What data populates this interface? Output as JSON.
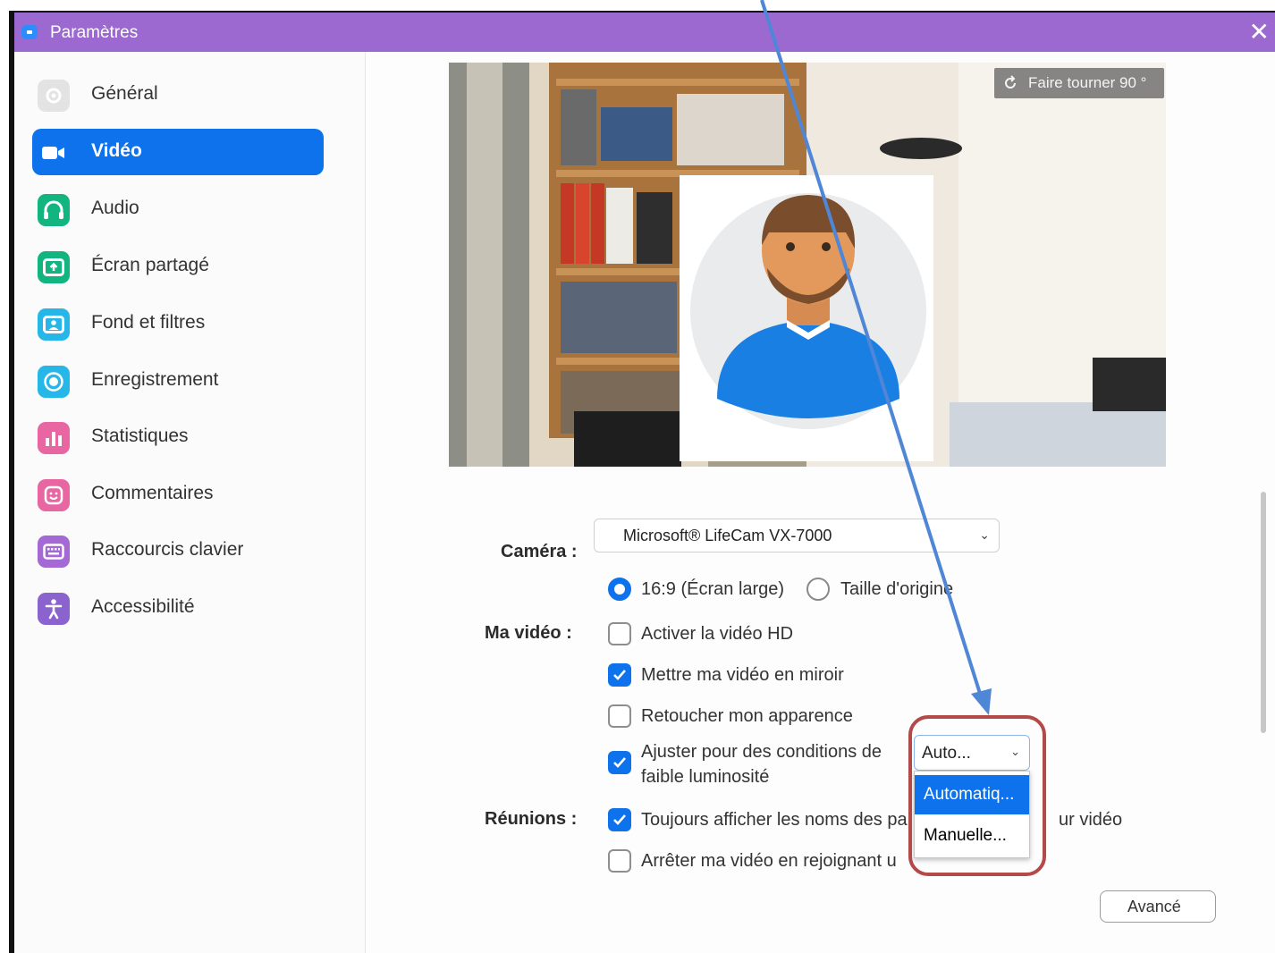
{
  "window": {
    "title": "Paramètres"
  },
  "sidebar": {
    "items": [
      {
        "label": "Général",
        "icon": "gear-icon",
        "color": "#e3e3e3",
        "active": false
      },
      {
        "label": "Vidéo",
        "icon": "video-camera-icon",
        "color": "#0e72ed",
        "active": true
      },
      {
        "label": "Audio",
        "icon": "headphones-icon",
        "color": "#12b57f",
        "active": false
      },
      {
        "label": "Écran partagé",
        "icon": "share-screen-icon",
        "color": "#12b57f",
        "active": false
      },
      {
        "label": "Fond et filtres",
        "icon": "background-person-icon",
        "color": "#26b6e8",
        "active": false
      },
      {
        "label": "Enregistrement",
        "icon": "record-icon",
        "color": "#26b6e8",
        "active": false
      },
      {
        "label": "Statistiques",
        "icon": "bar-chart-icon",
        "color": "#e867a3",
        "active": false
      },
      {
        "label": "Commentaires",
        "icon": "smile-icon",
        "color": "#e867a3",
        "active": false
      },
      {
        "label": "Raccourcis clavier",
        "icon": "keyboard-icon",
        "color": "#a569d6",
        "active": false
      },
      {
        "label": "Accessibilité",
        "icon": "accessibility-icon",
        "color": "#8a63cf",
        "active": false
      }
    ]
  },
  "preview": {
    "rotate_label": "Faire tourner 90 °"
  },
  "camera": {
    "label": "Caméra :",
    "selected": "Microsoft® LifeCam VX-7000",
    "ratio_wide": "16:9 (Écran large)",
    "ratio_original": "Taille d'origine"
  },
  "my_video": {
    "label": "Ma vidéo :",
    "options": [
      {
        "label": "Activer la vidéo HD",
        "checked": false
      },
      {
        "label": "Mettre ma vidéo en miroir",
        "checked": true
      },
      {
        "label": "Retoucher mon apparence",
        "checked": false
      }
    ],
    "low_light": {
      "line1": "Ajuster pour des conditions de",
      "line2": "faible luminosité",
      "checked": true,
      "mode_value": "Auto...",
      "dropdown": [
        "Automatiq...",
        "Manuelle..."
      ]
    }
  },
  "meetings": {
    "label": "Réunions :",
    "options": [
      {
        "label": "Toujours afficher les noms des pa",
        "tail": "ur vidéo",
        "checked": true
      },
      {
        "label": "Arrêter ma vidéo en rejoignant u",
        "checked": false
      }
    ]
  },
  "advanced_label": "Avancé",
  "colors": {
    "accent": "#0e72ed",
    "titlebar": "#9b69cf",
    "annotation_arrow": "#4f86d6",
    "highlight_box": "#b34a4a"
  }
}
